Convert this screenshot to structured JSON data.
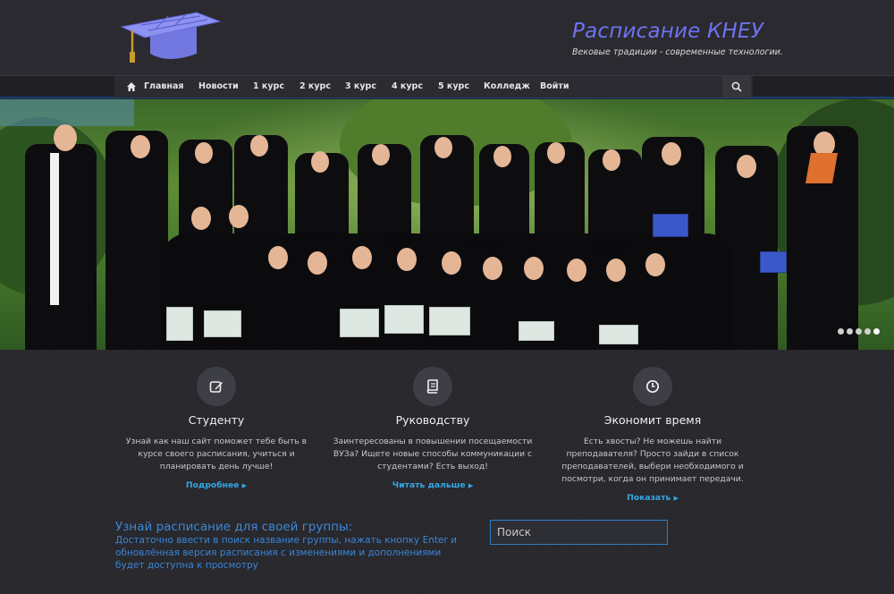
{
  "header": {
    "title": "Расписание КНЕУ",
    "tagline": "Вековые традиции - современные технологии.",
    "logo_icon": "graduation-cap-icon",
    "accent_color": "#6f73f0"
  },
  "nav": {
    "items": [
      {
        "label": "Главная",
        "icon": "home-icon"
      },
      {
        "label": "Новости"
      },
      {
        "label": "1 курс"
      },
      {
        "label": "2 курс"
      },
      {
        "label": "3 курс"
      },
      {
        "label": "4 курс"
      },
      {
        "label": "5 курс"
      },
      {
        "label": "Колледж"
      },
      {
        "label": "Войти"
      }
    ],
    "search_icon": "search-icon"
  },
  "slider": {
    "slide_count": 5,
    "active_slide": 5
  },
  "features": [
    {
      "icon": "edit-icon",
      "title": "Студенту",
      "text": "Узнай как наш сайт поможет тебе быть в курсе своего расписания, учиться и планировать день лучше!",
      "link": "Подробнее"
    },
    {
      "icon": "book-icon",
      "title": "Руководству",
      "text": "Заинтересованы в повышении посещаемости ВУЗа? Ищете новые способы коммуникации с студентами? Есть выход!",
      "link": "Читать дальше"
    },
    {
      "icon": "clock-icon",
      "title": "Экономит время",
      "text": "Есть хвосты? Не можешь найти преподавателя? Просто зайди в список преподавателей, выбери необходимого и посмотри, когда он принимает передачи.",
      "link": "Показать"
    }
  ],
  "schedule": {
    "title": "Узнай расписание для своей группы:",
    "text": "Достаточно ввести в поиск название группы, нажать кнопку Enter и обновлённая версия расписания с изменениями и дополнениями будет доступна к просмотру",
    "search_placeholder": "Поиск"
  },
  "colors": {
    "link": "#35a7e6",
    "schedule_text": "#3a85d6",
    "background": "#27272c"
  }
}
